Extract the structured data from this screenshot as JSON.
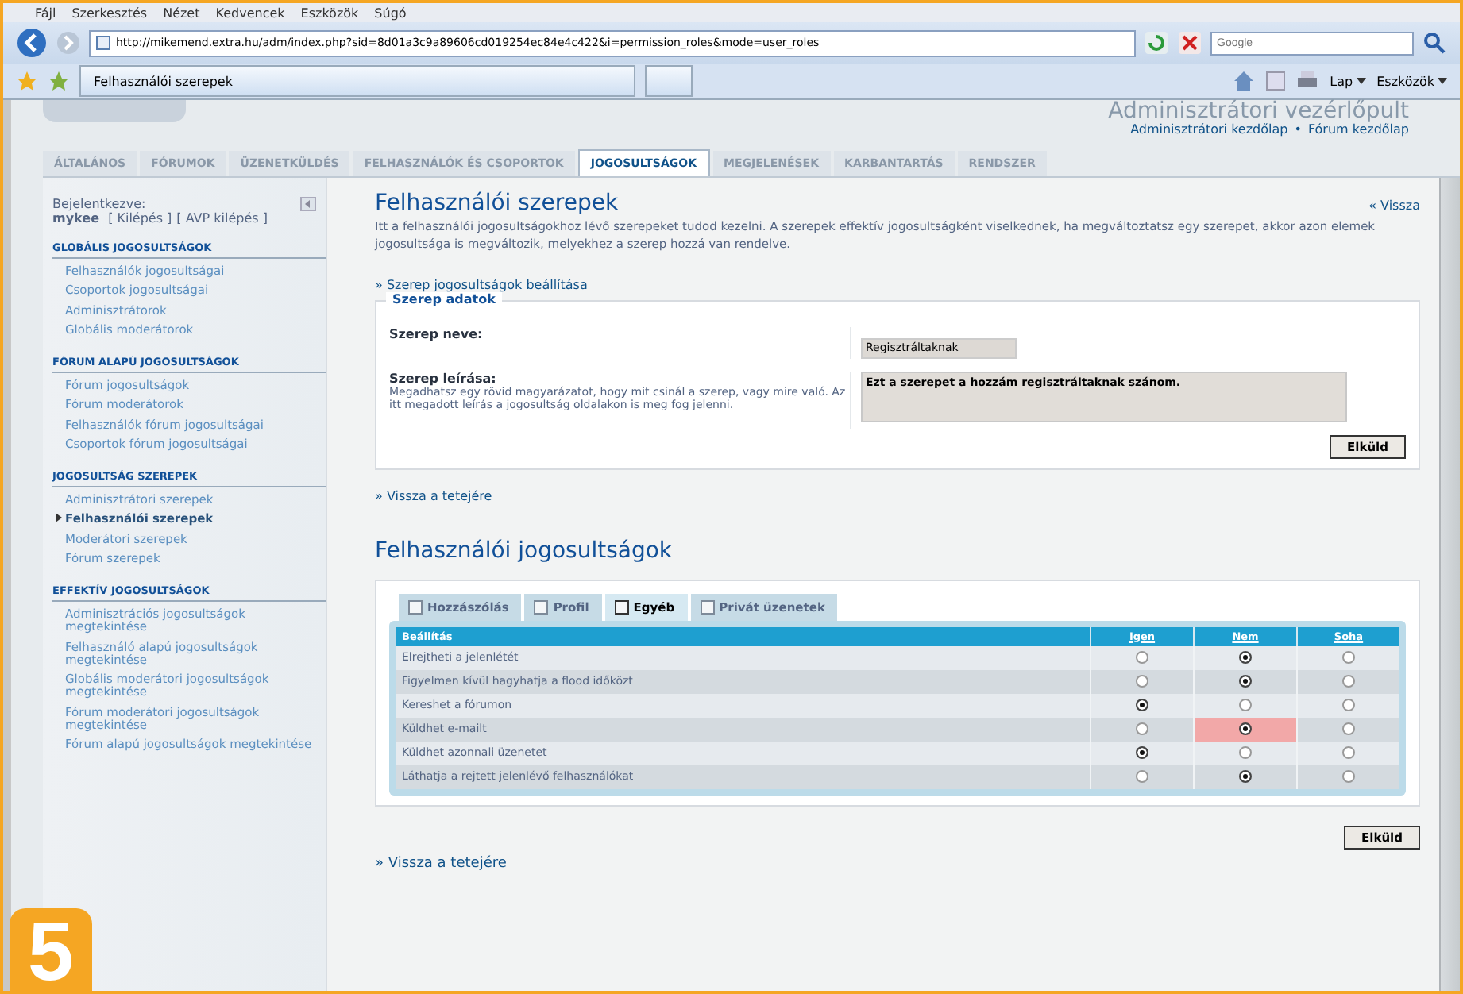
{
  "browser": {
    "menu": [
      "Fájl",
      "Szerkesztés",
      "Nézet",
      "Kedvencek",
      "Eszközök",
      "Súgó"
    ],
    "address": "http://mikemend.extra.hu/adm/index.php?sid=8d01a3c9a89606cd019254ec84e4c422&i=permission_roles&mode=user_roles",
    "search_placeholder": "Google",
    "tab": "Felhasználói szerepek",
    "tools": [
      "Lap",
      "Eszközök"
    ]
  },
  "header": {
    "title": "Adminisztrátori vezérlőpult",
    "links": [
      "Adminisztrátori kezdőlap",
      "Fórum kezdőlap"
    ],
    "separator": "•"
  },
  "tabs": [
    {
      "label": "ÁLTALÁNOS",
      "selected": false
    },
    {
      "label": "FÓRUMOK",
      "selected": false
    },
    {
      "label": "ÜZENETKÜLDÉS",
      "selected": false
    },
    {
      "label": "FELHASZNÁLÓK ÉS CSOPORTOK",
      "selected": false
    },
    {
      "label": "JOGOSULTSÁGOK",
      "selected": true
    },
    {
      "label": "MEGJELENÉSEK",
      "selected": false
    },
    {
      "label": "KARBANTARTÁS",
      "selected": false
    },
    {
      "label": "RENDSZER",
      "selected": false
    }
  ],
  "sidebar": {
    "logged_in_label": "Bejelentkezve:",
    "user": "mykee",
    "logout": "[ Kilépés ]",
    "avp_logout": "[ AVP kilépés ]",
    "sections": [
      {
        "title": "GLOBÁLIS JOGOSULTSÁGOK",
        "items": [
          {
            "label": "Felhasználók jogosultságai",
            "selected": false
          },
          {
            "label": "Csoportok jogosultságai",
            "selected": false
          },
          {
            "label": "Adminisztrátorok",
            "selected": false
          },
          {
            "label": "Globális moderátorok",
            "selected": false
          }
        ]
      },
      {
        "title": "FÓRUM ALAPÚ JOGOSULTSÁGOK",
        "items": [
          {
            "label": "Fórum jogosultságok",
            "selected": false
          },
          {
            "label": "Fórum moderátorok",
            "selected": false
          },
          {
            "label": "Felhasználók fórum jogosultságai",
            "selected": false
          },
          {
            "label": "Csoportok fórum jogosultságai",
            "selected": false
          }
        ]
      },
      {
        "title": "JOGOSULTSÁG SZEREPEK",
        "items": [
          {
            "label": "Adminisztrátori szerepek",
            "selected": false
          },
          {
            "label": "Felhasználói szerepek",
            "selected": true
          },
          {
            "label": "Moderátori szerepek",
            "selected": false
          },
          {
            "label": "Fórum szerepek",
            "selected": false
          }
        ]
      },
      {
        "title": "EFFEKTÍV JOGOSULTSÁGOK",
        "items": [
          {
            "label": "Adminisztrációs jogosultságok megtekintése",
            "selected": false
          },
          {
            "label": "Felhasználó alapú jogosultságok megtekintése",
            "selected": false
          },
          {
            "label": "Globális moderátori jogosultságok megtekintése",
            "selected": false
          },
          {
            "label": "Fórum moderátori jogosultságok megtekintése",
            "selected": false
          },
          {
            "label": "Fórum alapú jogosultságok megtekintése",
            "selected": false
          }
        ]
      }
    ]
  },
  "main": {
    "title": "Felhasználói szerepek",
    "back": "« Vissza",
    "intro": "Itt a felhasználói jogosultságokhoz lévő szerepeket tudod kezelni. A szerepek effektív jogosultságként viselkednek, ha megváltoztatsz egy szerepet, akkor azon elemek jogosultsága is megváltozik, melyekhez a szerep hozzá van rendelve.",
    "settings_link": "» Szerep jogosultságok beállítása",
    "fieldset": {
      "legend": "Szerep adatok",
      "name_label": "Szerep neve:",
      "name_value": "Regisztráltaknak",
      "desc_label": "Szerep leírása:",
      "desc_hint": "Megadhatsz egy rövid magyarázatot, hogy mit csinál a szerep, vagy mire való. Az itt megadott leírás a jogosultság oldalakon is meg fog jelenni.",
      "desc_value": "Ezt a szerepet a hozzám regisztráltaknak szánom.",
      "submit": "Elküld"
    },
    "top_link": "» Vissza a tetejére",
    "perm_title": "Felhasználói jogosultságok",
    "perm_tabs": [
      {
        "label": "Hozzászólás",
        "selected": false
      },
      {
        "label": "Profil",
        "selected": false
      },
      {
        "label": "Egyéb",
        "selected": true
      },
      {
        "label": "Privát üzenetek",
        "selected": false
      }
    ],
    "columns": [
      "Beállítás",
      "Igen",
      "Nem",
      "Soha"
    ],
    "rows": [
      {
        "label": "Elrejtheti a jelenlétét",
        "options": [
          {
            "selected": false,
            "changed": false
          },
          {
            "selected": true,
            "changed": false
          },
          {
            "selected": false,
            "changed": false
          }
        ]
      },
      {
        "label": "Figyelmen kívül hagyhatja a flood időközt",
        "options": [
          {
            "selected": false,
            "changed": false
          },
          {
            "selected": true,
            "changed": false
          },
          {
            "selected": false,
            "changed": false
          }
        ]
      },
      {
        "label": "Kereshet a fórumon",
        "options": [
          {
            "selected": true,
            "changed": false
          },
          {
            "selected": false,
            "changed": false
          },
          {
            "selected": false,
            "changed": false
          }
        ]
      },
      {
        "label": "Küldhet e-mailt",
        "options": [
          {
            "selected": false,
            "changed": false
          },
          {
            "selected": true,
            "changed": true
          },
          {
            "selected": false,
            "changed": false
          }
        ]
      },
      {
        "label": "Küldhet azonnali üzenetet",
        "options": [
          {
            "selected": true,
            "changed": false
          },
          {
            "selected": false,
            "changed": false
          },
          {
            "selected": false,
            "changed": false
          }
        ]
      },
      {
        "label": "Láthatja a rejtett jelenlévő felhasználókat",
        "options": [
          {
            "selected": false,
            "changed": false
          },
          {
            "selected": true,
            "changed": false
          },
          {
            "selected": false,
            "changed": false
          }
        ]
      }
    ],
    "submit": "Elküld",
    "bottom_link": "» Vissza a tetejére"
  },
  "figure_number": "5"
}
